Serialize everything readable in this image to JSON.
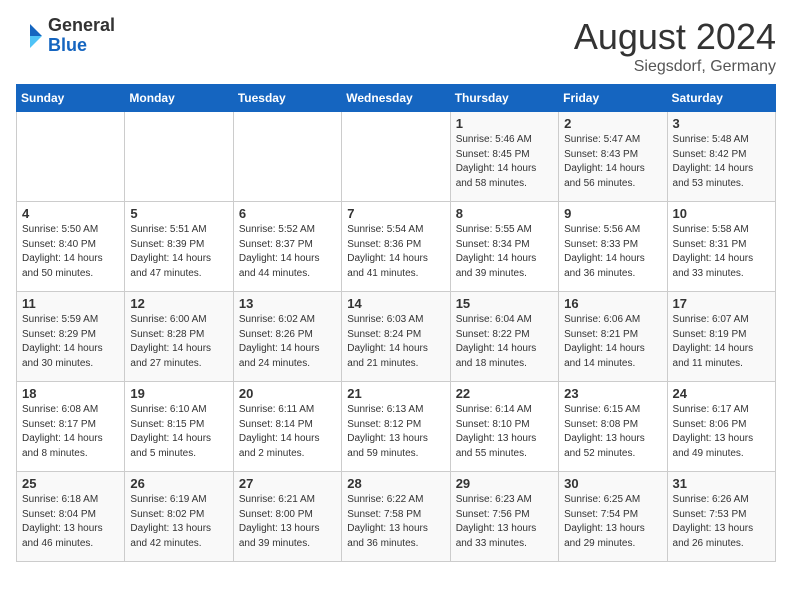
{
  "header": {
    "logo_general": "General",
    "logo_blue": "Blue",
    "month_title": "August 2024",
    "location": "Siegsdorf, Germany"
  },
  "days_of_week": [
    "Sunday",
    "Monday",
    "Tuesday",
    "Wednesday",
    "Thursday",
    "Friday",
    "Saturday"
  ],
  "weeks": [
    [
      {
        "day": "",
        "info": ""
      },
      {
        "day": "",
        "info": ""
      },
      {
        "day": "",
        "info": ""
      },
      {
        "day": "",
        "info": ""
      },
      {
        "day": "1",
        "info": "Sunrise: 5:46 AM\nSunset: 8:45 PM\nDaylight: 14 hours\nand 58 minutes."
      },
      {
        "day": "2",
        "info": "Sunrise: 5:47 AM\nSunset: 8:43 PM\nDaylight: 14 hours\nand 56 minutes."
      },
      {
        "day": "3",
        "info": "Sunrise: 5:48 AM\nSunset: 8:42 PM\nDaylight: 14 hours\nand 53 minutes."
      }
    ],
    [
      {
        "day": "4",
        "info": "Sunrise: 5:50 AM\nSunset: 8:40 PM\nDaylight: 14 hours\nand 50 minutes."
      },
      {
        "day": "5",
        "info": "Sunrise: 5:51 AM\nSunset: 8:39 PM\nDaylight: 14 hours\nand 47 minutes."
      },
      {
        "day": "6",
        "info": "Sunrise: 5:52 AM\nSunset: 8:37 PM\nDaylight: 14 hours\nand 44 minutes."
      },
      {
        "day": "7",
        "info": "Sunrise: 5:54 AM\nSunset: 8:36 PM\nDaylight: 14 hours\nand 41 minutes."
      },
      {
        "day": "8",
        "info": "Sunrise: 5:55 AM\nSunset: 8:34 PM\nDaylight: 14 hours\nand 39 minutes."
      },
      {
        "day": "9",
        "info": "Sunrise: 5:56 AM\nSunset: 8:33 PM\nDaylight: 14 hours\nand 36 minutes."
      },
      {
        "day": "10",
        "info": "Sunrise: 5:58 AM\nSunset: 8:31 PM\nDaylight: 14 hours\nand 33 minutes."
      }
    ],
    [
      {
        "day": "11",
        "info": "Sunrise: 5:59 AM\nSunset: 8:29 PM\nDaylight: 14 hours\nand 30 minutes."
      },
      {
        "day": "12",
        "info": "Sunrise: 6:00 AM\nSunset: 8:28 PM\nDaylight: 14 hours\nand 27 minutes."
      },
      {
        "day": "13",
        "info": "Sunrise: 6:02 AM\nSunset: 8:26 PM\nDaylight: 14 hours\nand 24 minutes."
      },
      {
        "day": "14",
        "info": "Sunrise: 6:03 AM\nSunset: 8:24 PM\nDaylight: 14 hours\nand 21 minutes."
      },
      {
        "day": "15",
        "info": "Sunrise: 6:04 AM\nSunset: 8:22 PM\nDaylight: 14 hours\nand 18 minutes."
      },
      {
        "day": "16",
        "info": "Sunrise: 6:06 AM\nSunset: 8:21 PM\nDaylight: 14 hours\nand 14 minutes."
      },
      {
        "day": "17",
        "info": "Sunrise: 6:07 AM\nSunset: 8:19 PM\nDaylight: 14 hours\nand 11 minutes."
      }
    ],
    [
      {
        "day": "18",
        "info": "Sunrise: 6:08 AM\nSunset: 8:17 PM\nDaylight: 14 hours\nand 8 minutes."
      },
      {
        "day": "19",
        "info": "Sunrise: 6:10 AM\nSunset: 8:15 PM\nDaylight: 14 hours\nand 5 minutes."
      },
      {
        "day": "20",
        "info": "Sunrise: 6:11 AM\nSunset: 8:14 PM\nDaylight: 14 hours\nand 2 minutes."
      },
      {
        "day": "21",
        "info": "Sunrise: 6:13 AM\nSunset: 8:12 PM\nDaylight: 13 hours\nand 59 minutes."
      },
      {
        "day": "22",
        "info": "Sunrise: 6:14 AM\nSunset: 8:10 PM\nDaylight: 13 hours\nand 55 minutes."
      },
      {
        "day": "23",
        "info": "Sunrise: 6:15 AM\nSunset: 8:08 PM\nDaylight: 13 hours\nand 52 minutes."
      },
      {
        "day": "24",
        "info": "Sunrise: 6:17 AM\nSunset: 8:06 PM\nDaylight: 13 hours\nand 49 minutes."
      }
    ],
    [
      {
        "day": "25",
        "info": "Sunrise: 6:18 AM\nSunset: 8:04 PM\nDaylight: 13 hours\nand 46 minutes."
      },
      {
        "day": "26",
        "info": "Sunrise: 6:19 AM\nSunset: 8:02 PM\nDaylight: 13 hours\nand 42 minutes."
      },
      {
        "day": "27",
        "info": "Sunrise: 6:21 AM\nSunset: 8:00 PM\nDaylight: 13 hours\nand 39 minutes."
      },
      {
        "day": "28",
        "info": "Sunrise: 6:22 AM\nSunset: 7:58 PM\nDaylight: 13 hours\nand 36 minutes."
      },
      {
        "day": "29",
        "info": "Sunrise: 6:23 AM\nSunset: 7:56 PM\nDaylight: 13 hours\nand 33 minutes."
      },
      {
        "day": "30",
        "info": "Sunrise: 6:25 AM\nSunset: 7:54 PM\nDaylight: 13 hours\nand 29 minutes."
      },
      {
        "day": "31",
        "info": "Sunrise: 6:26 AM\nSunset: 7:53 PM\nDaylight: 13 hours\nand 26 minutes."
      }
    ]
  ]
}
